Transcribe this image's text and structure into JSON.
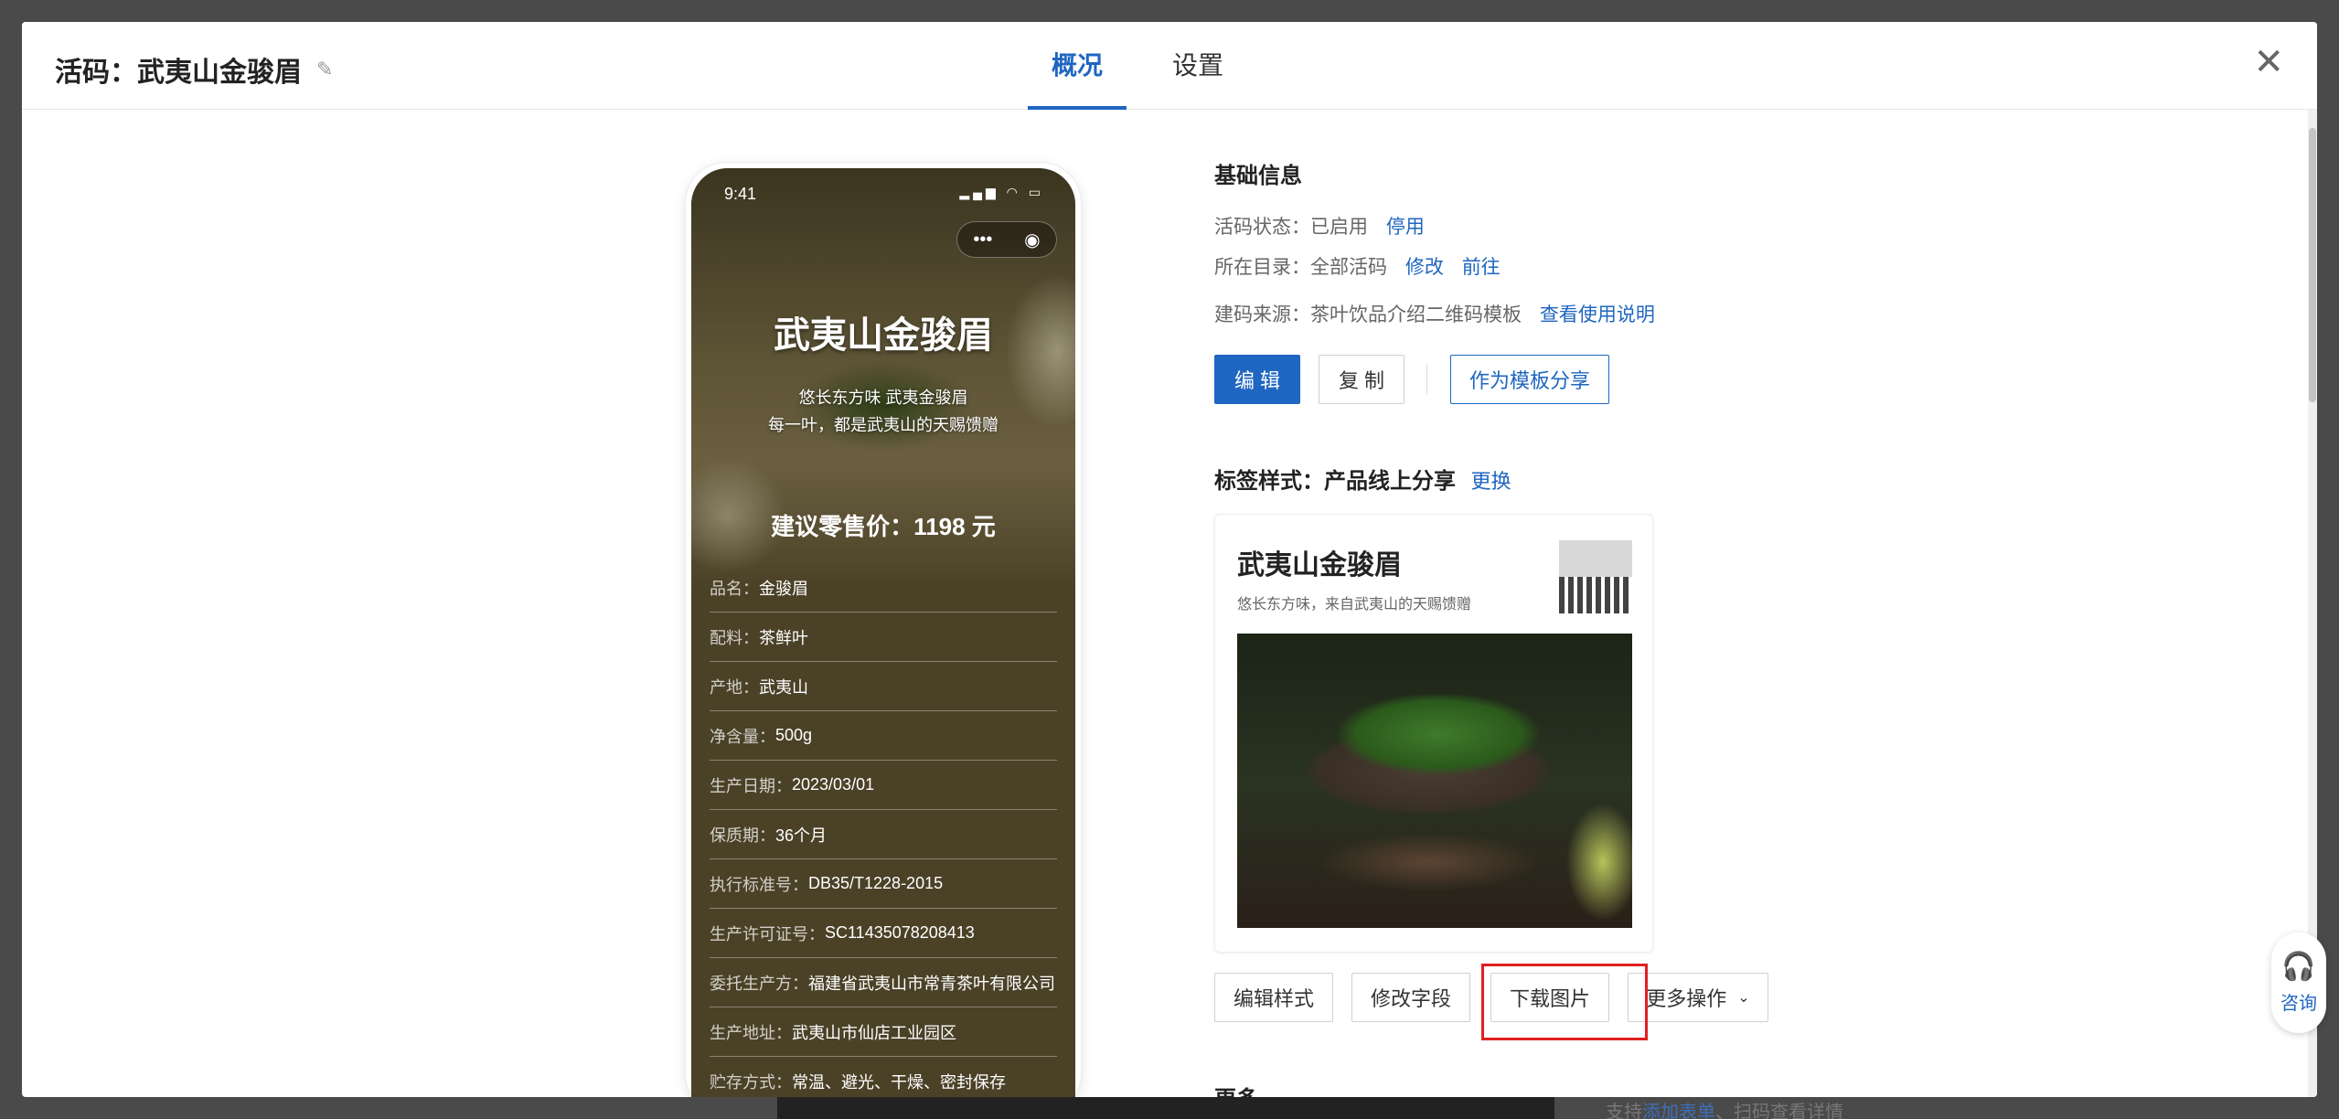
{
  "modal": {
    "title": "活码：武夷山金骏眉",
    "tabs": [
      "概况",
      "设置"
    ],
    "active_tab": "概况"
  },
  "phone": {
    "time": "9:41",
    "title": "武夷山金骏眉",
    "subtitle_line1": "悠长东方味 武夷金骏眉",
    "subtitle_line2": "每一叶，都是武夷山的天赐馈赠",
    "price": "建议零售价：1198 元",
    "rows": [
      {
        "k": "品名：",
        "v": "金骏眉"
      },
      {
        "k": "配料：",
        "v": "茶鲜叶"
      },
      {
        "k": "产地：",
        "v": "武夷山"
      },
      {
        "k": "净含量：",
        "v": "500g"
      },
      {
        "k": "生产日期：",
        "v": "2023/03/01"
      },
      {
        "k": "保质期：",
        "v": "36个月"
      },
      {
        "k": "执行标准号：",
        "v": "DB35/T1228-2015"
      },
      {
        "k": "生产许可证号：",
        "v": "SC11435078208413"
      },
      {
        "k": "委托生产方：",
        "v": "福建省武夷山市常青茶叶有限公司"
      },
      {
        "k": "生产地址：",
        "v": "武夷山市仙店工业园区"
      },
      {
        "k": "贮存方式：",
        "v": "常温、避光、干燥、密封保存"
      }
    ]
  },
  "basic": {
    "title": "基础信息",
    "status_label": "活码状态：",
    "status_value": "已启用",
    "status_action": "停用",
    "dir_label": "所在目录：",
    "dir_value": "全部活码",
    "dir_edit": "修改",
    "dir_go": "前往",
    "source_label": "建码来源：",
    "source_value": "茶叶饮品介绍二维码模板",
    "source_help": "查看使用说明",
    "btn_edit": "编 辑",
    "btn_copy": "复 制",
    "btn_share": "作为模板分享"
  },
  "label_style": {
    "title": "标签样式：产品线上分享",
    "change": "更换",
    "card_title": "武夷山金骏眉",
    "card_sub": "悠长东方味，来自武夷山的天赐馈赠",
    "btn_edit_style": "编辑样式",
    "btn_edit_fields": "修改字段",
    "btn_download": "下载图片",
    "btn_more": "更多操作"
  },
  "more_title": "更多",
  "help_float": "咨询",
  "backdrop": {
    "prefix": "支持",
    "link": "添加表单",
    "suffix": "、扫码查看详情"
  }
}
